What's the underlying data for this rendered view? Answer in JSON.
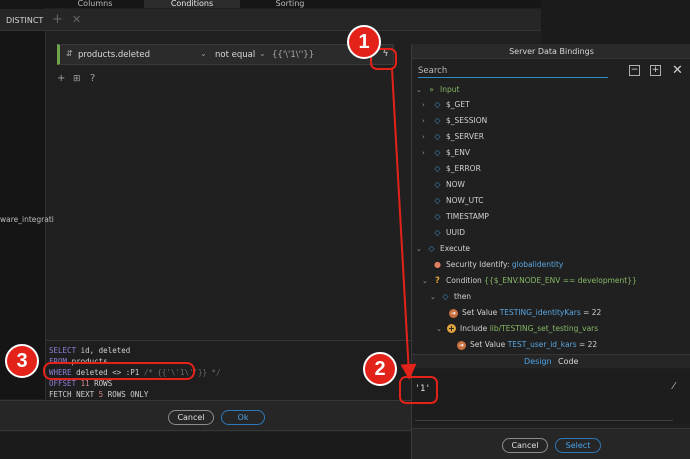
{
  "tabs": [
    "Columns",
    "Conditions",
    "Sorting"
  ],
  "distinct_label": "DISTINCT",
  "side_fragment": "ware_integrati",
  "condition": {
    "field": "products.deleted",
    "operator": "not equal",
    "value": "{{'\\'1\\''}}"
  },
  "sql": {
    "select_kw": "SELECT",
    "select_cols": " id, deleted",
    "from_kw": "FROM",
    "from_table": " products",
    "where_kw": "WHERE",
    "where_expr": " deleted <> :P1 ",
    "where_comment": "/* {{'\\'1\\''}} */",
    "offset_kw": "OFFSET",
    "offset_num": " 11",
    "offset_rows": " ROWS",
    "fetch_kw": "FETCH NEXT",
    "fetch_num": " 5",
    "fetch_rest": " ROWS ONLY"
  },
  "builder_buttons": {
    "cancel": "Cancel",
    "ok": "Ok"
  },
  "panel": {
    "title": "Server Data Bindings",
    "search_placeholder": "Search",
    "tree": {
      "input": "Input",
      "get": "$_GET",
      "session": "$_SESSION",
      "server": "$_SERVER",
      "env": "$_ENV",
      "error": "$_ERROR",
      "now": "NOW",
      "now_utc": "NOW_UTC",
      "timestamp": "TIMESTAMP",
      "uuid": "UUID",
      "execute": "Execute",
      "security_label": "Security Identify: ",
      "security_value": "globalidentity",
      "condition_label": "Condition ",
      "condition_value": "{{$_ENV.NODE_ENV == development}}",
      "then": "then",
      "setvalue1_label": "Set Value ",
      "setvalue1_value": "TESTING_identityKars",
      "setvalue1_eq": " = 22",
      "include_label": "Include ",
      "include_value": "lib/TESTING_set_testing_vars",
      "setvalue2_label": "Set Value ",
      "setvalue2_value": "TEST_user_id_kars",
      "setvalue2_eq": " = 22"
    },
    "tab_design": "Design",
    "tab_code": "Code",
    "expression": "'1'",
    "buttons": {
      "cancel": "Cancel",
      "select": "Select"
    }
  },
  "badges": [
    "1",
    "2",
    "3"
  ],
  "annotation_color": "#e3221a",
  "accent_color": "#2f89c6"
}
